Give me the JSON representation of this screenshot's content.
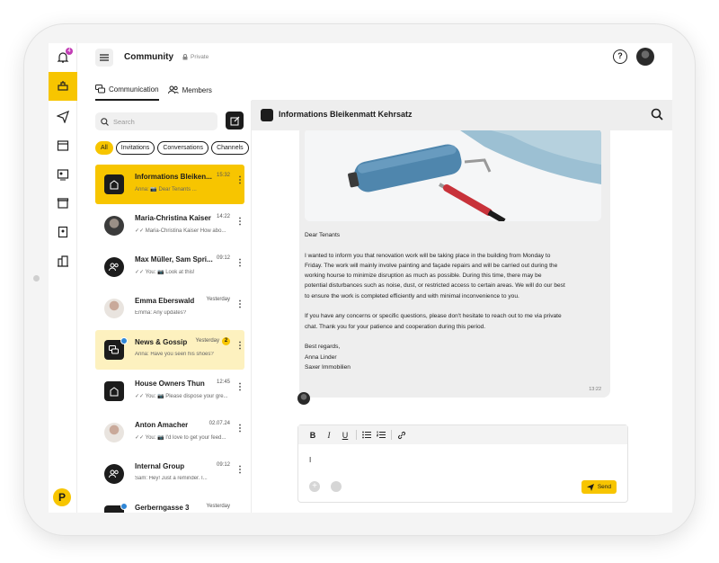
{
  "header": {
    "title": "Community",
    "privacy": "Private"
  },
  "tabs": [
    {
      "label": "Communication",
      "active": true
    },
    {
      "label": "Members",
      "active": false
    }
  ],
  "search": {
    "placeholder": "Search"
  },
  "filters": [
    "All",
    "Invitations",
    "Conversations",
    "Channels"
  ],
  "rail": {
    "notification_count": "4"
  },
  "conversations": [
    {
      "name": "Informations Bleiken...",
      "time": "15:32",
      "preview": "Anna: 📷 Dear Tenants ...",
      "state": "selected"
    },
    {
      "name": "Maria-Christina Kaiser",
      "time": "14:22",
      "preview": "✓✓ Maria-Christina Kaiser How abo...",
      "state": ""
    },
    {
      "name": "Max Müller, Sam Spri...",
      "time": "09:12",
      "preview": "✓✓ You: 📷 Look at this!",
      "state": ""
    },
    {
      "name": "Emma Eberswald",
      "time": "Yesterday",
      "preview": "Emma: Any updates?",
      "state": ""
    },
    {
      "name": "News & Gossip",
      "time": "Yesterday",
      "count": "2",
      "preview": "Anna: Have you seen his shoes?",
      "state": "highlight"
    },
    {
      "name": "House Owners Thun",
      "time": "12:45",
      "preview": "✓✓ You: 📷 Please dispose your gre...",
      "state": ""
    },
    {
      "name": "Anton Amacher",
      "time": "02.07.24",
      "preview": "✓✓ You: 📷 I'd love to get your feed...",
      "state": ""
    },
    {
      "name": "Internal Group",
      "time": "09:12",
      "preview": "Sam: Hey! Just a reminder. I...",
      "state": ""
    },
    {
      "name": "Gerberngasse 3",
      "time": "Yesterday",
      "preview": "",
      "state": ""
    }
  ],
  "chat": {
    "title": "Informations Bleikenmatt Kehrsatz",
    "message": {
      "greeting": "Dear Tenants",
      "body1": "I wanted to inform you that renovation work will be taking place in the building from Monday to Friday. The work will mainly involve painting and façade repairs and will be carried out during the working hourse to minimize disruption as much as possible. During this time, there may be potential disturbances such as noise, dust, or restricted access to certain areas. We will do our best to ensure the work is completed efficiently and with minimal inconvenience to you.",
      "body2": "If you have any concerns or specific questions, please don't hesitate to reach out to me via private chat. Thank you for your patience and cooperation during this period.",
      "closing": "Best regards,",
      "signature_name": "Anna Linder",
      "signature_org": "Saxer Immobilien",
      "time": "13:22"
    }
  },
  "composer": {
    "text": "I",
    "send_label": "Send"
  },
  "colors": {
    "accent": "#f7c500",
    "dark": "#1c1c1c",
    "highlight": "#fdf1bf"
  }
}
